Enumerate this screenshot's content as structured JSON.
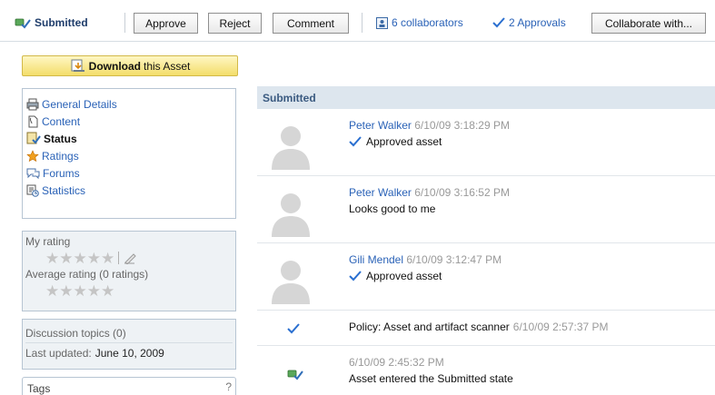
{
  "toolbar": {
    "status_label": "Submitted",
    "approve_label": "Approve",
    "reject_label": "Reject",
    "comment_label": "Comment",
    "collaborators_label": "6 collaborators",
    "approvals_label": "2 Approvals",
    "collaborate_label": "Collaborate with..."
  },
  "sidebar": {
    "download_bold": "Download",
    "download_rest": "this Asset",
    "nav": [
      {
        "label": "General Details",
        "icon": "printer-icon",
        "active": false
      },
      {
        "label": "Content",
        "icon": "document-icon",
        "active": false
      },
      {
        "label": "Status",
        "icon": "status-icon",
        "active": true
      },
      {
        "label": "Ratings",
        "icon": "star-icon",
        "active": false
      },
      {
        "label": "Forums",
        "icon": "speech-bubbles-icon",
        "active": false
      },
      {
        "label": "Statistics",
        "icon": "statistics-icon",
        "active": false
      }
    ],
    "my_rating_label": "My rating",
    "average_rating_label": "Average rating (0 ratings)",
    "my_rating_value": 0,
    "average_rating_value": 0,
    "rating_max": 5,
    "discussion_label": "Discussion topics (0)",
    "last_updated_label": "Last updated:",
    "last_updated_value": "June 10, 2009",
    "tags_label": "Tags",
    "tags_help": "?"
  },
  "activity": {
    "header": "Submitted",
    "entries": [
      {
        "author": "Peter Walker",
        "time": "6/10/09 3:18:29 PM",
        "text": "Approved asset"
      },
      {
        "author": "Peter Walker",
        "time": "6/10/09 3:16:52 PM",
        "text": "Looks good to me"
      },
      {
        "author": "Gili Mendel",
        "time": "6/10/09 3:12:47 PM",
        "text": "Approved asset"
      },
      {
        "text": "Policy: Asset and artifact scanner",
        "time": "6/10/09 2:57:37 PM"
      },
      {
        "time": "6/10/09 2:45:32 PM",
        "text": "Asset entered the Submitted state"
      }
    ]
  },
  "colors": {
    "link": "#2a62b7",
    "header_bg": "#dde6ee",
    "download_bg": "#f3dd6a",
    "check": "#2a6fd0"
  }
}
